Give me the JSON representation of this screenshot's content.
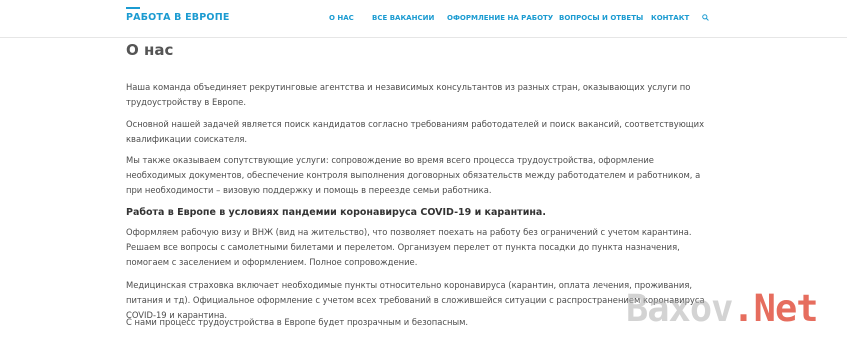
{
  "header": {
    "logo": "РАБОТА В ЕВРОПЕ",
    "nav": [
      {
        "label": "О НАС"
      },
      {
        "label": "ВСЕ ВАКАНСИИ"
      },
      {
        "label": "ОФОРМЛЕНИЕ НА РАБОТУ"
      },
      {
        "label": "ВОПРОСЫ И ОТВЕТЫ"
      },
      {
        "label": "КОНТАКТ"
      }
    ],
    "search_icon": "search-icon"
  },
  "main": {
    "title": "О нас",
    "paragraphs": [
      "Наша команда объединяет рекрутинговые агентства и независимых консультантов из разных стран, оказывающих услуги по трудоустройству в Европе.",
      "Основной нашей задачей является поиск кандидатов согласно требованиям работодателей и поиск вакансий, соответствующих квалификации соискателя.",
      "Мы также оказываем сопутствующие услуги: сопровождение во время всего процесса трудоустройства, оформление необходимых документов, обеспечение контроля выполнения договорных обязательств между работодателем и работником, а при необходимости – визовую поддержку и помощь в переезде семьи работника."
    ],
    "subheading": "Работа в Европе в условиях пандемии коронавируса COVID-19 и карантина.",
    "paragraphs2": [
      "Оформляем рабочую визу и ВНЖ (вид на жительство), что позволяет поехать на работу без ограничений с учетом карантина. Решаем все вопросы с самолетными билетами и перелетом. Организуем перелет от пункта посадки до пункта назначения, помогаем с заселением и оформлением. Полное сопровождение.",
      "Медицинская страховка включает необходимые пункты относительно коронавируса (карантин, оплата лечения, проживания, питания и тд). Официальное оформление с учетом всех требований в сложившейся ситуации с распространением коронавируса COVID-19 и карантина.",
      "С нами процесс трудоустройства в Европе будет прозрачным и безопасным."
    ]
  },
  "watermark": {
    "part1": "Baxov",
    "dot": ".",
    "part2": "Net"
  },
  "colors": {
    "accent": "#1b9bd1",
    "text": "#4d4d4d",
    "watermark_red": "#dd3c28"
  }
}
